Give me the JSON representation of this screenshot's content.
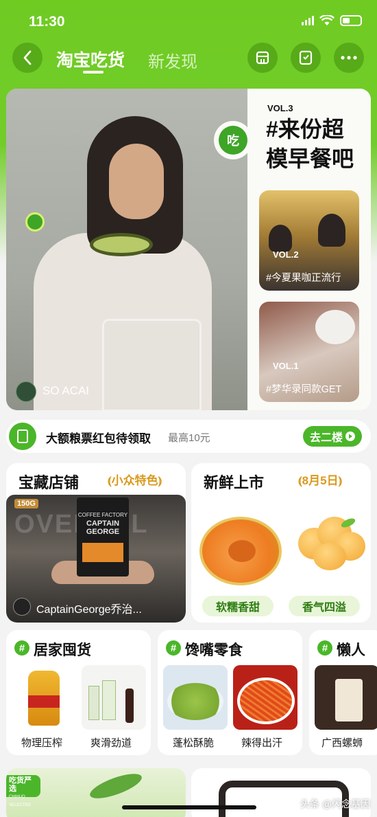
{
  "status": {
    "time": "11:30"
  },
  "nav": {
    "title": "淘宝吃货",
    "tab_second": "新发现"
  },
  "hero": {
    "badge_text": "吃",
    "video_label": "SO ACAI",
    "vol_main": "VOL.3",
    "title_line1": "#来份超",
    "title_line2": "模早餐吧",
    "cards": [
      {
        "vol": "VOL.2",
        "title": "#今夏果咖正流行"
      },
      {
        "vol": "VOL.1",
        "title": "#梦华录同款GET"
      }
    ]
  },
  "coupon": {
    "main": "大额粮票红包待领取",
    "sub": "最高10元",
    "button": "去二楼"
  },
  "treasure": {
    "title": "宝藏店铺",
    "tag": "小众特色",
    "weight_badge": "150G",
    "shop_name": "CaptainGeorge乔治...",
    "bag_line1": "COFFEE FACTORY",
    "bag_line2": "CAPTAIN",
    "bag_line3": "GEORGE",
    "bg_text": "OVERALL"
  },
  "fresh": {
    "title": "新鲜上市",
    "date_tag": "8月5日",
    "pills": [
      "软糯香甜",
      "香气四溢"
    ]
  },
  "categories": [
    {
      "title": "居家囤货",
      "items": [
        "物理压榨",
        "爽滑劲道"
      ]
    },
    {
      "title": "馋嘴零食",
      "items": [
        "蓬松酥脆",
        "辣得出汗"
      ]
    },
    {
      "title": "懒人",
      "items": [
        "广西螺蛳"
      ]
    }
  ],
  "bottom": {
    "badge_top": "吃货严选",
    "badge_bottom": "CHIHUO SELECTED"
  },
  "watermark": "头条 @闪念基因"
}
